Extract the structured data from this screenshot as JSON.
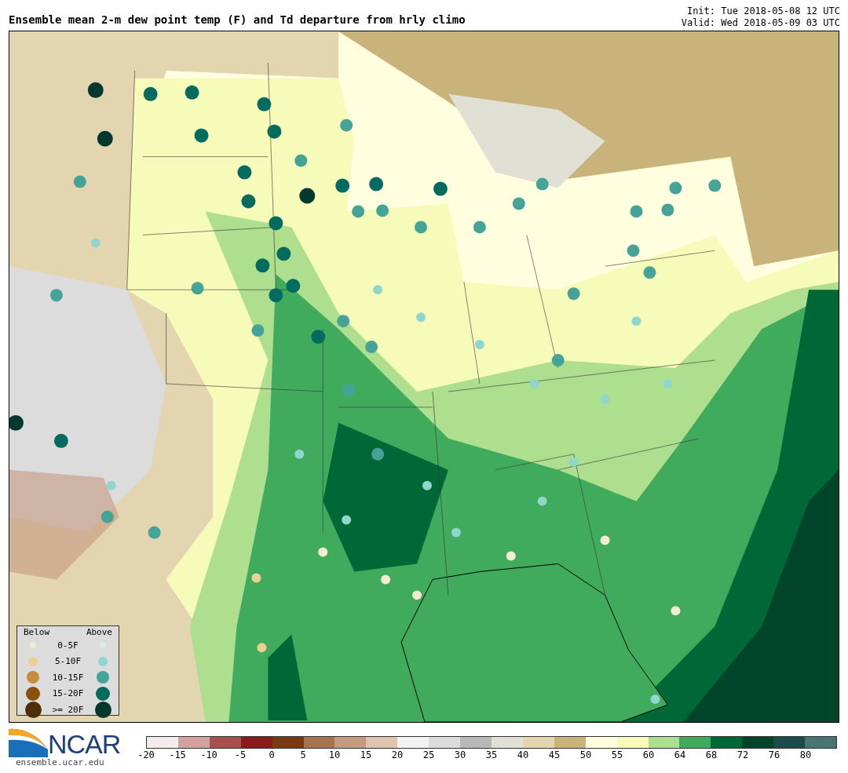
{
  "title": "Ensemble mean 2-m dew point temp (F) and Td departure from hrly climo",
  "init": "Init: Tue 2018-05-08 12 UTC",
  "valid": "Valid: Wed 2018-05-09 03 UTC",
  "legend": {
    "below_heading": "Below",
    "above_heading": "Above",
    "rows": [
      {
        "label": "0-5F",
        "below": {
          "color": "#f2ecd2"
        },
        "above": {
          "color": "#d8ecea"
        }
      },
      {
        "label": "5-10F",
        "below": {
          "color": "#ead092"
        },
        "above": {
          "color": "#8fd6cf"
        }
      },
      {
        "label": "10-15F",
        "below": {
          "color": "#c68d3e"
        },
        "above": {
          "color": "#45a398"
        }
      },
      {
        "label": "15-20F",
        "below": {
          "color": "#8b520e"
        },
        "above": {
          "color": "#056b5e"
        }
      },
      {
        "label": ">= 20F",
        "below": {
          "color": "#4f2e08"
        },
        "above": {
          "color": "#02382e"
        }
      }
    ]
  },
  "logo": {
    "name": "NCAR",
    "url": "ensemble.ucar.edu"
  },
  "colorbar": [
    {
      "label": "-20",
      "color": "#f4eceb"
    },
    {
      "label": "-15",
      "color": "#d4a0a0"
    },
    {
      "label": "-10",
      "color": "#a84f4f"
    },
    {
      "label": "-5",
      "color": "#8b1a1a"
    },
    {
      "label": "0",
      "color": "#7a3a10"
    },
    {
      "label": "5",
      "color": "#a67550"
    },
    {
      "label": "10",
      "color": "#c49a80"
    },
    {
      "label": "15",
      "color": "#dcc4b0"
    },
    {
      "label": "20",
      "color": "#f2f2f2"
    },
    {
      "label": "25",
      "color": "#dcdcdc"
    },
    {
      "label": "30",
      "color": "#b8b8b8"
    },
    {
      "label": "35",
      "color": "#e0e0d4"
    },
    {
      "label": "40",
      "color": "#e3d5b0"
    },
    {
      "label": "45",
      "color": "#c9b37a"
    },
    {
      "label": "50",
      "color": "#ffffe0"
    },
    {
      "label": "55",
      "color": "#f7fbb9"
    },
    {
      "label": "60",
      "color": "#addf8e"
    },
    {
      "label": "64",
      "color": "#41ab5d"
    },
    {
      "label": "68",
      "color": "#006837"
    },
    {
      "label": "72",
      "color": "#004529"
    },
    {
      "label": "76",
      "color": "#1c4b4b"
    },
    {
      "label": "80",
      "color": "#4a7373"
    }
  ]
}
